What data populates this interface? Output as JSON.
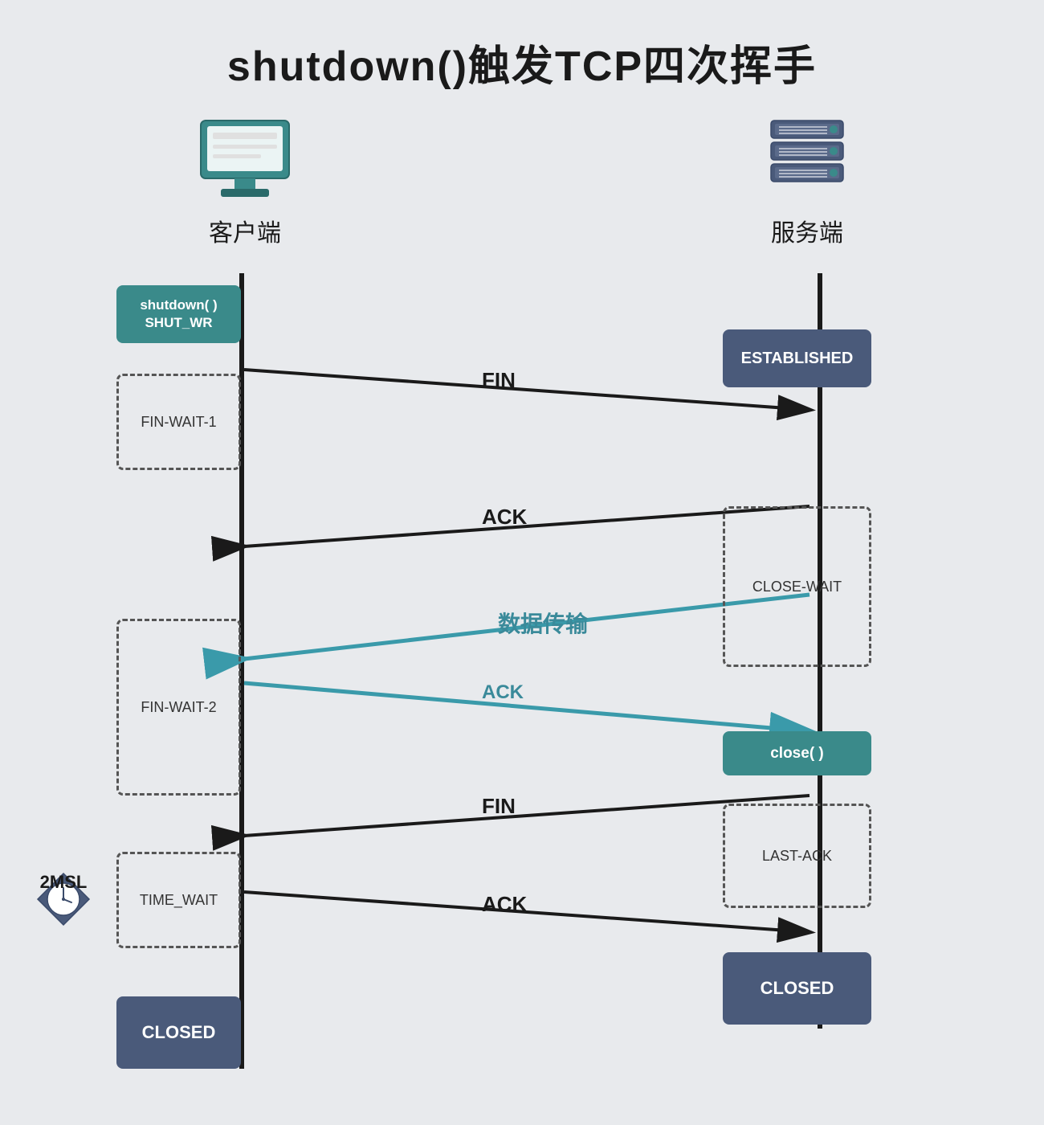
{
  "title": "shutdown()触发TCP四次挥手",
  "client_label": "客户端",
  "server_label": "服务端",
  "states": {
    "shutdown": "shutdown( )\nSHUT_WR",
    "fin_wait_1": "FIN-WAIT-1",
    "fin_wait_2": "FIN-WAIT-2",
    "time_wait": "TIME_WAIT",
    "closed_client": "CLOSED",
    "established": "ESTABLISHED",
    "close_wait": "CLOSE-WAIT",
    "close_fn": "close( )",
    "last_ack": "LAST-ACK",
    "closed_server": "CLOSED"
  },
  "arrows": {
    "fin1": "FIN",
    "ack1": "ACK",
    "data": "数据传输",
    "ack2": "ACK",
    "fin2": "FIN",
    "ack3": "ACK"
  },
  "timer": "2MSL",
  "colors": {
    "solid_box": "#4a5a7a",
    "teal_box": "#3a8a8a",
    "timeline": "#1a1a1a",
    "arrow": "#1a1a1a",
    "teal_arrow": "#3a9aaa",
    "dashed_border": "#555555",
    "background": "#e8eaed"
  }
}
